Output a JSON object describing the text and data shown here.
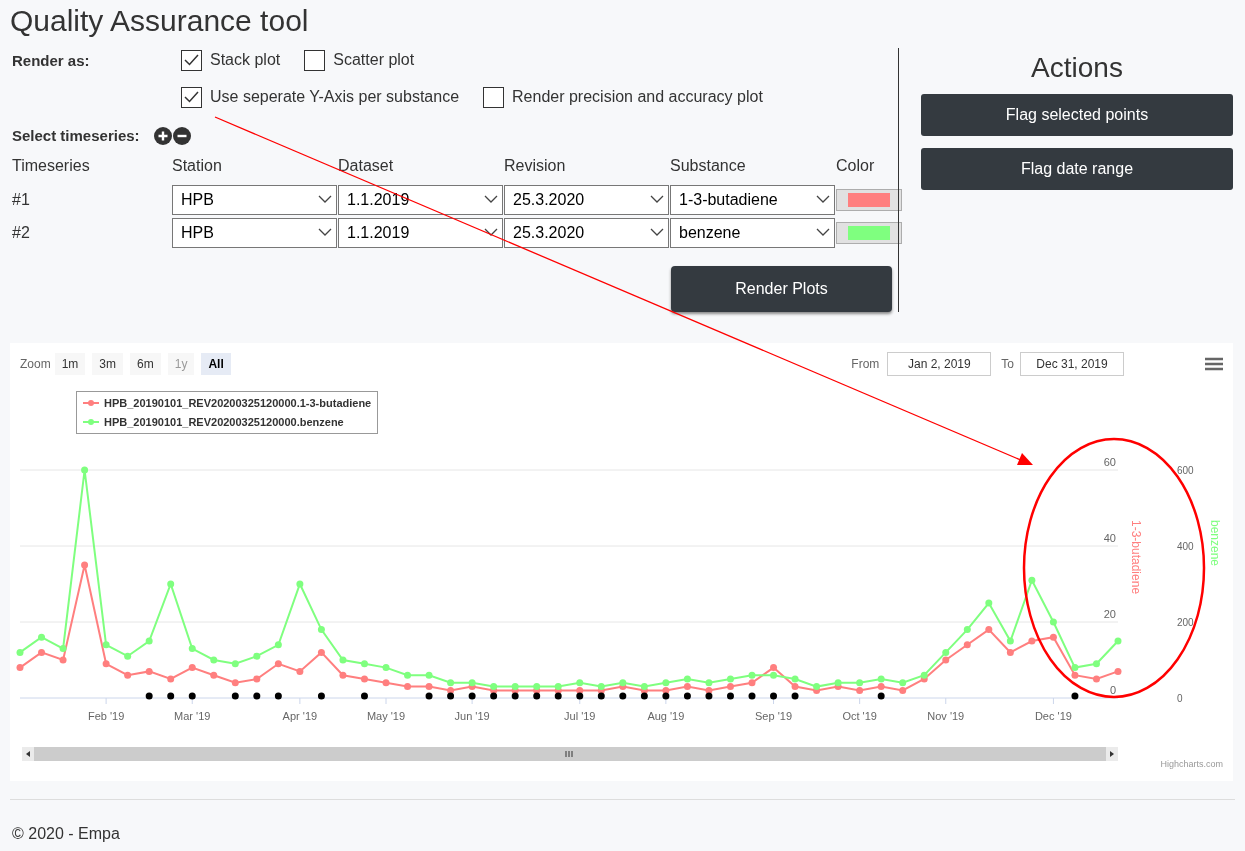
{
  "title": "Quality Assurance tool",
  "render_options": {
    "label": "Render as:",
    "lines": [
      {
        "options": [
          {
            "label": "Stack plot",
            "checked": true
          },
          {
            "label": "Scatter plot",
            "checked": false
          }
        ]
      },
      {
        "options": [
          {
            "label": "Use seperate Y-Axis per substance",
            "checked": true
          },
          {
            "label": "Render precision and accuracy plot",
            "checked": false
          }
        ]
      }
    ]
  },
  "timeseries": {
    "label": "Select timeseries:",
    "columns": [
      "Timeseries",
      "Station",
      "Dataset",
      "Revision",
      "Substance",
      "Color"
    ],
    "rows": [
      {
        "index": "#1",
        "station": "HPB",
        "dataset": "1.1.2019",
        "revision": "25.3.2020",
        "substance": "1-3-butadiene",
        "color": "#ff7f7f"
      },
      {
        "index": "#2",
        "station": "HPB",
        "dataset": "1.1.2019",
        "revision": "25.3.2020",
        "substance": "benzene",
        "color": "#7fff7f"
      }
    ]
  },
  "render_button": "Render Plots",
  "actions": {
    "title": "Actions",
    "buttons": [
      "Flag selected points",
      "Flag date range"
    ]
  },
  "chart": {
    "zoom_label": "Zoom",
    "zoom_buttons": [
      {
        "label": "1m",
        "selected": false,
        "disabled": false
      },
      {
        "label": "3m",
        "selected": false,
        "disabled": false
      },
      {
        "label": "6m",
        "selected": false,
        "disabled": false
      },
      {
        "label": "1y",
        "selected": false,
        "disabled": true
      },
      {
        "label": "All",
        "selected": true,
        "disabled": false
      }
    ],
    "from_label": "From",
    "from": "Jan 2, 2019",
    "to_label": "To",
    "to": "Dec 31, 2019",
    "credit": "Highcharts.com",
    "chart_data": {
      "type": "line",
      "ylabel": "1-3-butadiene",
      "y2label": "benzene",
      "ylim": [
        0,
        60
      ],
      "y2lim": [
        0,
        600
      ],
      "yticks": [
        0,
        20,
        40,
        60
      ],
      "y2ticks": [
        0,
        200,
        400,
        600
      ],
      "categories": [
        null,
        null,
        null,
        null,
        "Feb '19",
        null,
        null,
        null,
        "Mar '19",
        null,
        null,
        null,
        null,
        "Apr '19",
        null,
        null,
        null,
        "May '19",
        null,
        null,
        null,
        "Jun '19",
        null,
        null,
        null,
        null,
        "Jul '19",
        null,
        null,
        null,
        "Aug '19",
        null,
        null,
        null,
        null,
        "Sep '19",
        null,
        null,
        null,
        "Oct '19",
        null,
        null,
        null,
        "Nov '19",
        null,
        null,
        null,
        null,
        "Dec '19",
        null,
        null,
        null
      ],
      "series": [
        {
          "name": "HPB_20190101_REV20200325120000.1-3-butadiene",
          "color": "#ff7f7f",
          "marker": true,
          "values": [
            8,
            12,
            10,
            35,
            9,
            6,
            7,
            5,
            8,
            6,
            4,
            5,
            9,
            7,
            12,
            6,
            5,
            4,
            3,
            3,
            2,
            3,
            2,
            2,
            2,
            2,
            2,
            2,
            3,
            2,
            2,
            3,
            2,
            3,
            4,
            8,
            3,
            2,
            3,
            2,
            3,
            2,
            5,
            10,
            14,
            18,
            12,
            15,
            16,
            6,
            5,
            7
          ]
        },
        {
          "name": "HPB_20190101_REV20200325120000.benzene",
          "color": "#7fff7f",
          "axis": "y2",
          "marker": true,
          "values": [
            120,
            160,
            130,
            600,
            140,
            110,
            150,
            300,
            130,
            100,
            90,
            110,
            140,
            300,
            180,
            100,
            90,
            80,
            60,
            60,
            40,
            40,
            30,
            30,
            30,
            30,
            40,
            30,
            40,
            30,
            40,
            50,
            40,
            50,
            60,
            60,
            50,
            30,
            40,
            40,
            50,
            40,
            60,
            120,
            180,
            250,
            150,
            310,
            200,
            80,
            90,
            150
          ]
        },
        {
          "type": "scatter",
          "color": "#000000",
          "values": [
            null,
            null,
            null,
            null,
            null,
            null,
            0.5,
            0.5,
            0.5,
            null,
            0.5,
            0.5,
            0.5,
            null,
            0.5,
            null,
            0.5,
            null,
            null,
            0.5,
            0.5,
            0.5,
            0.5,
            0.5,
            0.5,
            0.5,
            0.5,
            0.5,
            0.5,
            0.5,
            0.5,
            0.5,
            0.5,
            0.5,
            0.5,
            0.5,
            0.5,
            null,
            null,
            null,
            0.5,
            null,
            null,
            null,
            null,
            null,
            null,
            null,
            null,
            0.5,
            null,
            null
          ]
        }
      ]
    }
  },
  "footer": "© 2020 - Empa",
  "annotations": {
    "arrow": true,
    "ellipse": true
  }
}
